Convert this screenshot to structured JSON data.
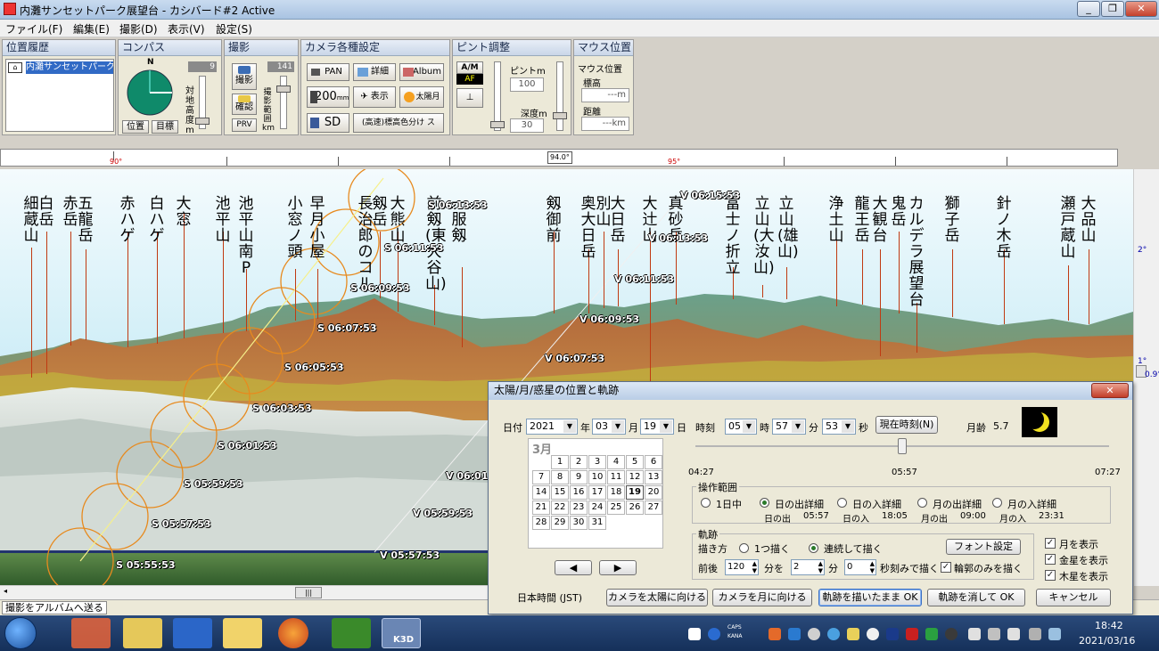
{
  "window": {
    "title": "内灘サンセットパーク展望台 - カシバード#2 Active"
  },
  "menu": [
    "ファイル(F)",
    "編集(E)",
    "撮影(D)",
    "表示(V)",
    "設定(S)"
  ],
  "panels": {
    "history": {
      "title": "位置履歴",
      "item": "内灘サンセットパーク展"
    },
    "compass": {
      "title": "コンパス",
      "north": "N",
      "value": "9",
      "vlabel": "対地高度m",
      "btn_position": "位置",
      "btn_target": "目標"
    },
    "shoot": {
      "title": "撮影",
      "btn_shoot": "撮影",
      "btn_confirm": "確認",
      "btn_prv": "PRV",
      "value": "141",
      "vlabel": "撮影範囲km"
    },
    "camera": {
      "title": "カメラ各種設定",
      "pan": "PAN",
      "detail": "詳細",
      "album": "Album",
      "lens": "200",
      "lens_unit": "mm",
      "display": "表示",
      "sunmoon": "太陽月",
      "sd": "SD",
      "color": "(高速)標高色分け ス"
    },
    "focus": {
      "title": "ピント調整",
      "am": "A/M",
      "af": "AF",
      "focus_label": "ピントm",
      "focus_value": "100",
      "depth_label": "深度m",
      "depth_value": "30"
    },
    "mouse": {
      "title": "マウス位置",
      "pos_label": "マウス位置",
      "alt_label": "標高",
      "alt_value": "---m",
      "dist_label": "距離",
      "dist_value": "---km"
    }
  },
  "ruler": {
    "left_label": "90°",
    "mid_label": "94.0°",
    "right_label": "95°"
  },
  "elevation_labels": [
    "2°",
    "1°",
    "0.9°"
  ],
  "peaks": [
    {
      "name": "細蔵山"
    },
    {
      "name": "白岳"
    },
    {
      "name": "赤岳"
    },
    {
      "name": "五龍岳"
    },
    {
      "name": "赤ハゲ"
    },
    {
      "name": "白ハゲ"
    },
    {
      "name": "大窓"
    },
    {
      "name": "池平山"
    },
    {
      "name": "池平山南P"
    },
    {
      "name": "小窓ノ頭"
    },
    {
      "name": "早月小屋"
    },
    {
      "name": "長治郎のコル"
    },
    {
      "name": "剱岳"
    },
    {
      "name": "大熊山"
    },
    {
      "name": "前剱(東大谷山)"
    },
    {
      "name": "一服剱"
    },
    {
      "name": "剱御前"
    },
    {
      "name": "奥大日岳"
    },
    {
      "name": "別山"
    },
    {
      "name": "大日岳"
    },
    {
      "name": "大辻山"
    },
    {
      "name": "真砂岳"
    },
    {
      "name": "富士ノ折立"
    },
    {
      "name": "立山(大汝山)"
    },
    {
      "name": "立山(雄山)"
    },
    {
      "name": "浄土山"
    },
    {
      "name": "龍王岳"
    },
    {
      "name": "大観台"
    },
    {
      "name": "鬼岳"
    },
    {
      "name": "カルデラ展望台"
    },
    {
      "name": "獅子岳"
    },
    {
      "name": "針ノ木岳"
    },
    {
      "name": "瀬戸蔵山"
    },
    {
      "name": "大品山"
    }
  ],
  "sun_track": [
    "S 05:55:53",
    "S 05:57:53",
    "S 05:59:53",
    "S 06:01:53",
    "S 06:03:53",
    "S 06:05:53",
    "S 06:07:53",
    "S 06:09:53",
    "S 06:11:53",
    "S 06:13:53"
  ],
  "venus_track": [
    "V 05:57:53",
    "V 05:59:53",
    "V 06:01",
    "V 06:07:53",
    "V 06:09:53",
    "V 06:11:53",
    "V 06:13:53",
    "V 06:15:53"
  ],
  "statusbar": {
    "album_label": "撮影をアルバムへ送る"
  },
  "dialog": {
    "title": "太陽/月/惑星の位置と軌跡",
    "date_label": "日付",
    "year": "2021",
    "year_unit": "年",
    "month": "03",
    "month_unit": "月",
    "day": "19",
    "day_unit": "日",
    "time_label": "時刻",
    "hour": "05",
    "hour_unit": "時",
    "minute": "57",
    "minute_unit": "分",
    "second": "53",
    "second_unit": "秒",
    "now_button": "現在時刻(N)",
    "moon_age_label": "月齢",
    "moon_age": "5.7",
    "calendar": {
      "month": "3月",
      "days": [
        "1",
        "2",
        "3",
        "4",
        "5",
        "6",
        "7",
        "8",
        "9",
        "10",
        "11",
        "12",
        "13",
        "14",
        "15",
        "16",
        "17",
        "18",
        "19",
        "20",
        "21",
        "22",
        "23",
        "24",
        "25",
        "26",
        "27",
        "28",
        "29",
        "30",
        "31"
      ]
    },
    "slider": {
      "start": "04:27",
      "mid": "05:57",
      "end": "07:27",
      "position": 0.5
    },
    "range_group": {
      "title": "操作範囲",
      "options": [
        "1日中",
        "日の出詳細",
        "日の入詳細",
        "月の出詳細",
        "月の入詳細"
      ],
      "selected": 1,
      "sunrise_label": "日の出",
      "sunrise": "05:57",
      "sunset_label": "日の入",
      "sunset": "18:05",
      "moonrise_label": "月の出",
      "moonrise": "09:00",
      "moonset_label": "月の入",
      "moonset": "23:31"
    },
    "track_group": {
      "title": "軌跡",
      "draw_label": "描き方",
      "opt_one": "1つ描く",
      "opt_continuous": "連続して描く",
      "font_button": "フォント設定",
      "before_after": "前後",
      "range_value": "120",
      "range_unit": "分を",
      "interval_value": "2",
      "interval_unit": "分",
      "second_value": "0",
      "second_unit": "秒刻みで描く",
      "outline_only": "輪郭のみを描く"
    },
    "checks": [
      "月を表示",
      "金星を表示",
      "木星を表示"
    ],
    "timezone": "日本時間 (JST)",
    "btn_sun": "カメラを太陽に向ける",
    "btn_moon": "カメラを月に向ける",
    "btn_keep": "軌跡を描いたまま OK",
    "btn_clear": "軌跡を消して OK",
    "btn_cancel": "キャンセル"
  },
  "taskbar": {
    "time": "18:42",
    "date": "2021/03/16",
    "caps": "CAPS",
    "kana": "KANA",
    "app_k3d": "K3D"
  }
}
